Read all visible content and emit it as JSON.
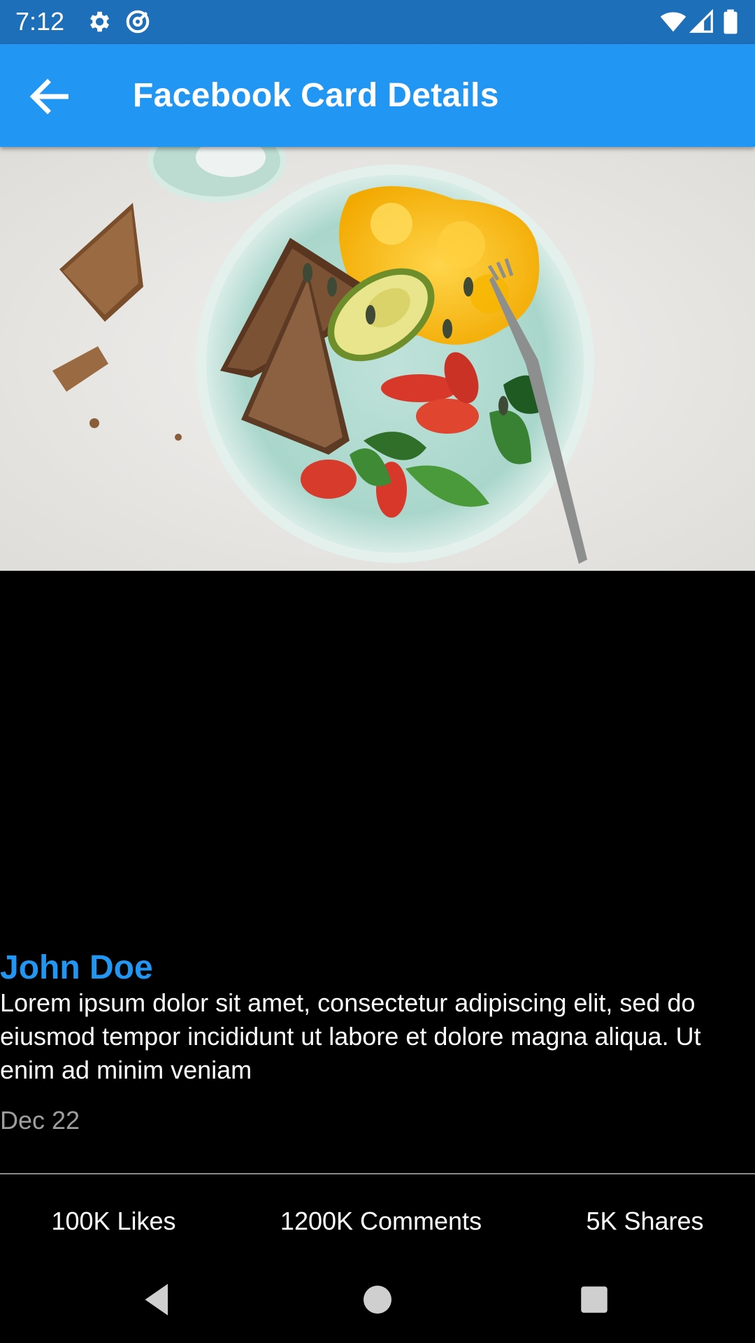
{
  "status_bar": {
    "time": "7:12",
    "left_icons": [
      "gear-icon",
      "at-sign-icon"
    ],
    "right_icons": [
      "wifi-icon",
      "cellular-signal-icon",
      "battery-icon"
    ]
  },
  "app_bar": {
    "title": "Facebook Card Details",
    "back_icon": "arrow-back-icon",
    "color": "#2196F3"
  },
  "hero_image": {
    "subject": "breakfast plate with scrambled eggs, avocado, toast, tomatoes and spinach"
  },
  "post": {
    "author": "John Doe",
    "body": "Lorem ipsum dolor sit amet, consectetur adipiscing elit, sed do eiusmod tempor incididunt ut labore et dolore magna aliqua. Ut enim ad minim veniam",
    "date": "Dec 22",
    "author_color": "#2196F3"
  },
  "stats": {
    "likes": "100K Likes",
    "comments": "1200K Comments",
    "shares": "5K Shares"
  },
  "nav_bar": {
    "buttons": [
      "back-triangle-icon",
      "home-circle-icon",
      "recents-square-icon"
    ]
  }
}
